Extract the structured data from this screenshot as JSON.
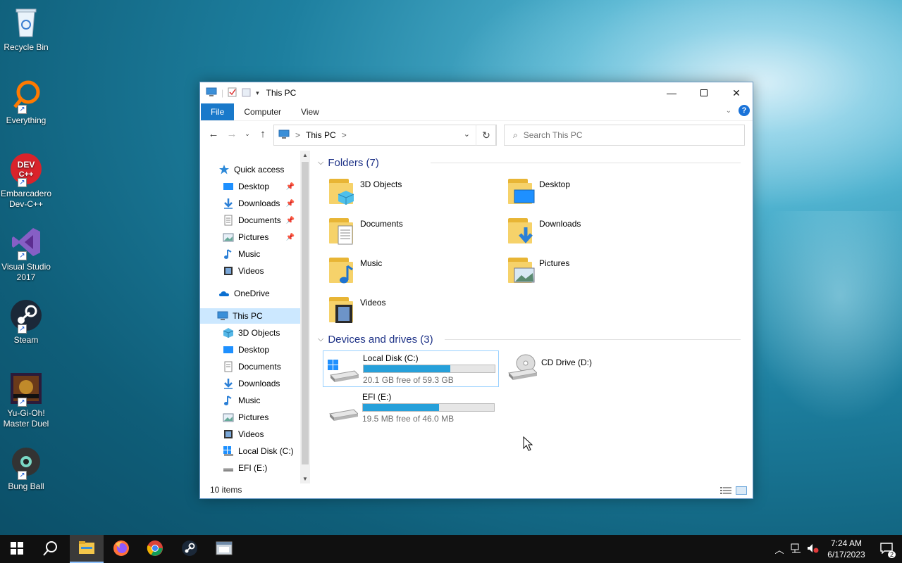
{
  "desktop": {
    "icons": [
      {
        "label": "Recycle Bin",
        "icon": "recycle-bin-icon"
      },
      {
        "label": "Everything",
        "icon": "everything-search-icon"
      },
      {
        "label": "Embarcadero Dev-C++",
        "icon": "devcpp-icon",
        "badge": "DEV C++"
      },
      {
        "label": "Visual Studio 2017",
        "icon": "visual-studio-icon"
      },
      {
        "label": "Steam",
        "icon": "steam-icon"
      },
      {
        "label": "Yu-Gi-Oh! Master Duel",
        "icon": "yugioh-icon"
      },
      {
        "label": "Bung Ball",
        "icon": "bung-ball-icon"
      }
    ]
  },
  "window": {
    "title": "This PC",
    "ribbon_tabs": [
      "File",
      "Computer",
      "View"
    ],
    "address": {
      "crumb": "This PC",
      "separator": ">"
    },
    "search_placeholder": "Search This PC",
    "nav": {
      "quick_access": "Quick access",
      "quick_items": [
        "Desktop",
        "Downloads",
        "Documents",
        "Pictures",
        "Music",
        "Videos"
      ],
      "onedrive": "OneDrive",
      "this_pc": "This PC",
      "pc_items": [
        "3D Objects",
        "Desktop",
        "Documents",
        "Downloads",
        "Music",
        "Pictures",
        "Videos",
        "Local Disk (C:)",
        "EFI (E:)"
      ]
    },
    "folders_header": "Folders (7)",
    "folders": [
      "3D Objects",
      "Desktop",
      "Documents",
      "Downloads",
      "Music",
      "Pictures",
      "Videos"
    ],
    "devices_header": "Devices and drives (3)",
    "drives": [
      {
        "name": "Local Disk (C:)",
        "free": "20.1 GB free of 59.3 GB",
        "used_fraction": 0.66
      },
      {
        "name": "CD Drive (D:)"
      },
      {
        "name": "EFI (E:)",
        "free": "19.5 MB free of 46.0 MB",
        "used_fraction": 0.58
      }
    ],
    "status": "10 items"
  },
  "taskbar": {
    "time": "7:24 AM",
    "date": "6/17/2023",
    "notification_count": "2"
  },
  "colors": {
    "accent": "#1979ca",
    "drive_bar": "#26a0da",
    "selection": "#cce8ff"
  }
}
